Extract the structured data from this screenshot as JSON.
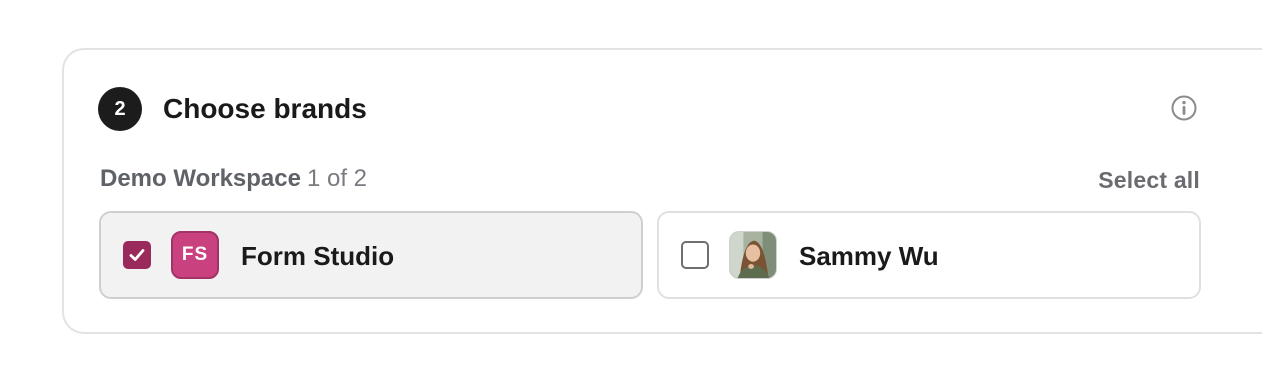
{
  "step": {
    "number": "2",
    "title": "Choose brands"
  },
  "workspace": {
    "name": "Demo Workspace",
    "count": "1 of 2",
    "select_all_label": "Select all"
  },
  "brands": [
    {
      "initials": "FS",
      "name": "Form Studio",
      "checked": true,
      "logo_color": "#c9427f"
    },
    {
      "name": "Sammy Wu",
      "checked": false,
      "avatar": "person-photo"
    }
  ],
  "colors": {
    "accent": "#9a2a5c",
    "badge_bg": "#1c1c1c"
  }
}
